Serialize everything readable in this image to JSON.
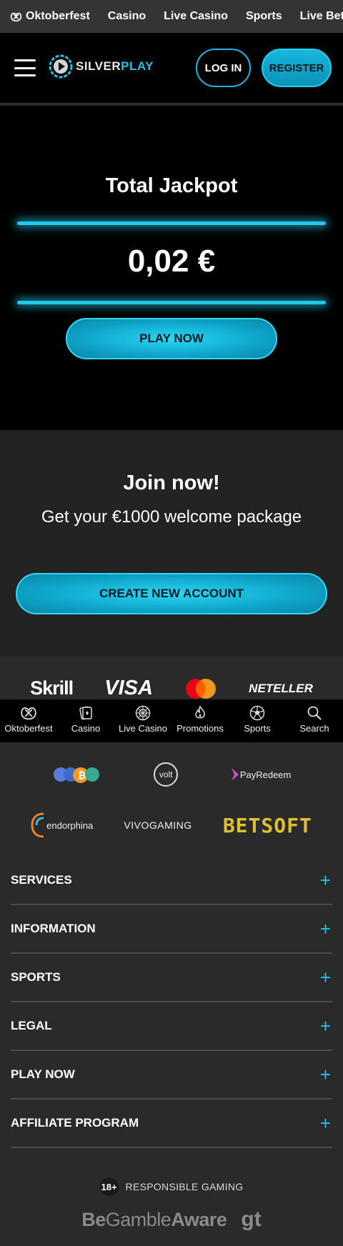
{
  "topnav": {
    "items": [
      {
        "label": "Oktoberfest",
        "icon": "pretzel-icon"
      },
      {
        "label": "Casino"
      },
      {
        "label": "Live Casino"
      },
      {
        "label": "Sports"
      },
      {
        "label": "Live Betting"
      }
    ]
  },
  "header": {
    "logo_part1": "SILVER",
    "logo_part2": "PLAY",
    "login_label": "LOG IN",
    "register_label": "REGISTER"
  },
  "jackpot": {
    "title": "Total Jackpot",
    "amount": "0,02 €",
    "play_label": "PLAY NOW"
  },
  "join": {
    "title": "Join now!",
    "subtitle": "Get your €1000 welcome package",
    "cta_label": "CREATE NEW ACCOUNT"
  },
  "payments": {
    "skrill": "Skrill",
    "visa": "VISA",
    "neteller": "NETELLER"
  },
  "bottomnav": {
    "items": [
      {
        "label": "Oktoberfest",
        "icon": "pretzel-icon"
      },
      {
        "label": "Casino",
        "icon": "cards-icon"
      },
      {
        "label": "Live Casino",
        "icon": "roulette-icon"
      },
      {
        "label": "Promotions",
        "icon": "flame-icon"
      },
      {
        "label": "Sports",
        "icon": "soccer-ball-icon"
      },
      {
        "label": "Search",
        "icon": "search-icon"
      }
    ]
  },
  "providers": {
    "volt": "volt",
    "payredeem": "PayRedeem",
    "endorphina": "endorphina",
    "vivogaming": "VIVOGAMING",
    "betsoft": "BETSOFT"
  },
  "accordion": {
    "items": [
      {
        "label": "SERVICES"
      },
      {
        "label": "INFORMATION"
      },
      {
        "label": "SPORTS"
      },
      {
        "label": "LEGAL"
      },
      {
        "label": "PLAY NOW"
      },
      {
        "label": "AFFILIATE PROGRAM"
      }
    ],
    "expand_symbol": "+"
  },
  "responsible": {
    "age": "18+",
    "text": "RESPONSIBLE GAMING",
    "begamble_be": "Be",
    "begamble_gamble": "Gamble",
    "begamble_aware": "Aware",
    "gt": "gt"
  },
  "colors": {
    "accent": "#1fc3e6",
    "background": "#2a2a2a",
    "header": "#000000"
  }
}
